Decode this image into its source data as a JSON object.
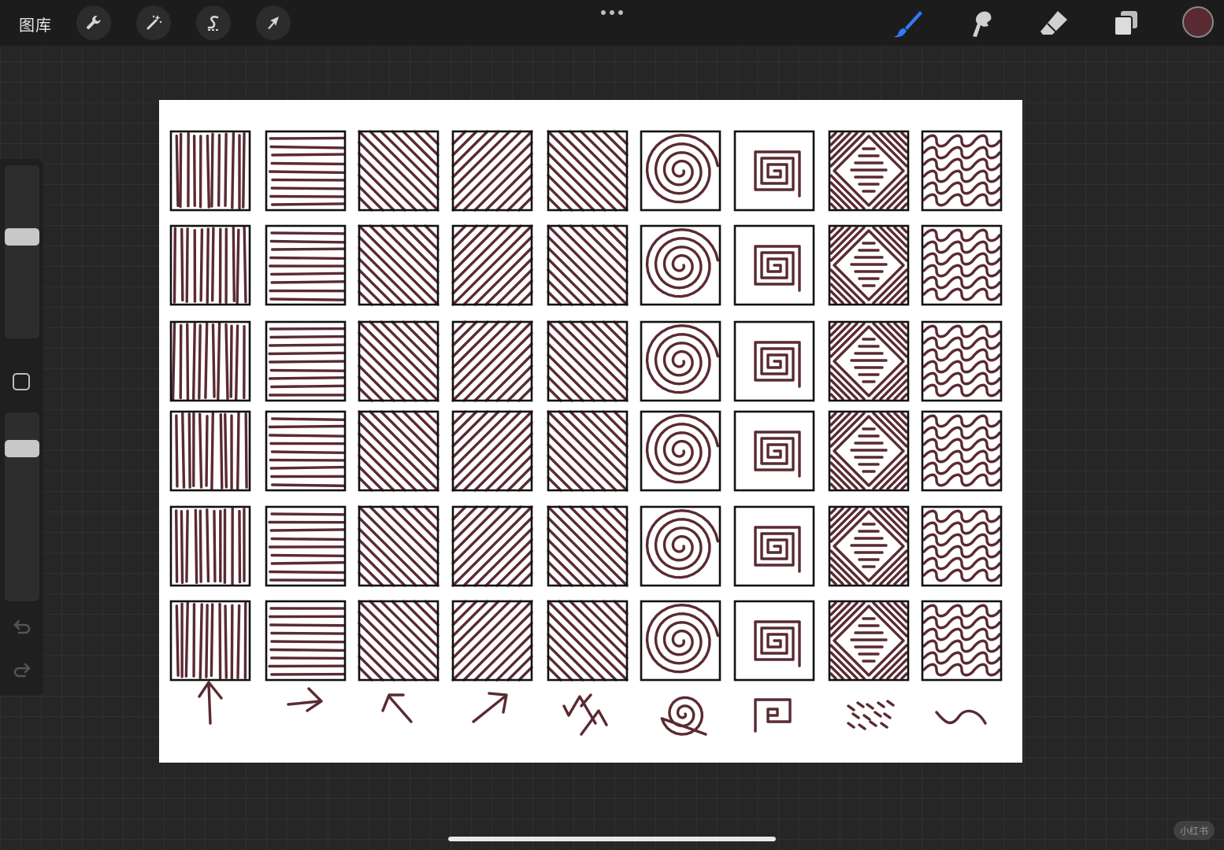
{
  "topbar": {
    "gallery_label": "图库",
    "left_tools": [
      {
        "name": "actions",
        "icon": "wrench-icon"
      },
      {
        "name": "adjustments",
        "icon": "magic-wand-icon"
      },
      {
        "name": "selection",
        "icon": "selection-s-icon"
      },
      {
        "name": "transform",
        "icon": "arrow-cursor-icon"
      }
    ],
    "more_icon": "ellipsis-icon",
    "right_tools": [
      {
        "name": "brush",
        "icon": "brush-icon",
        "active": true
      },
      {
        "name": "smudge",
        "icon": "smudge-icon",
        "active": false
      },
      {
        "name": "eraser",
        "icon": "eraser-icon",
        "active": false
      },
      {
        "name": "layers",
        "icon": "layers-icon",
        "active": false
      }
    ],
    "current_color": "#5a2a32",
    "active_color": "#2f7bf5"
  },
  "sidebar": {
    "brush_size_level": 0.35,
    "opacity_level": 0.95,
    "icons": [
      "modify-square-icon",
      "undo-icon",
      "redo-icon"
    ]
  },
  "canvas": {
    "ink_color": "#5a2a32",
    "grid": {
      "rows": 6,
      "columns": 9
    },
    "patterns": [
      "vertical-lines",
      "horizontal-lines",
      "diagonal-backslash",
      "diagonal-slash",
      "diagonal-backslash",
      "spiral",
      "square-spiral",
      "diamond",
      "waves"
    ],
    "direction_hints": [
      "arrow-up",
      "arrow-right",
      "arrow-up-left",
      "arrow-up-right",
      "zigzag-arrows",
      "spiral",
      "square-spiral",
      "scatter-strokes",
      "wave"
    ]
  },
  "watermark": "小红书"
}
